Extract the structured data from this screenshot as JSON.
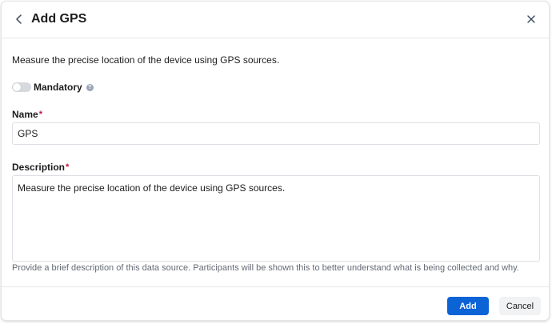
{
  "dialog": {
    "title": "Add GPS",
    "back_icon": "chevron-left-icon",
    "close_icon": "close-icon"
  },
  "intro": "Measure the precise location of the device using GPS sources.",
  "mandatory": {
    "label": "Mandatory",
    "enabled": false,
    "help_icon": "question-circle-icon"
  },
  "name_field": {
    "label": "Name",
    "required_mark": "*",
    "value": "GPS"
  },
  "description_field": {
    "label": "Description",
    "required_mark": "*",
    "value": "Measure the precise location of the device using GPS sources.",
    "helper": "Provide a brief description of this data source. Participants will be shown this to better understand what is being collected and why."
  },
  "footer": {
    "add_label": "Add",
    "cancel_label": "Cancel"
  },
  "colors": {
    "primary": "#0b63d6",
    "required": "#c4123c",
    "toggle_off": "#d6d9de"
  }
}
